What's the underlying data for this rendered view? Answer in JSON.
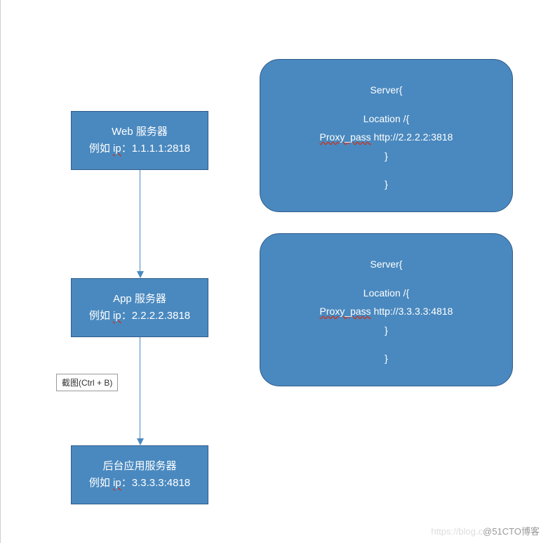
{
  "nodes": {
    "web": {
      "title": "Web 服务器",
      "subtitle_prefix": "例如 ",
      "subtitle_ip_label": "ip",
      "subtitle_value": "：1.1.1.1:2818"
    },
    "app": {
      "title": "App 服务器",
      "subtitle_prefix": "例如 ",
      "subtitle_ip_label": "ip",
      "subtitle_value": "：2.2.2.2.3818"
    },
    "backend": {
      "title": "后台应用服务器",
      "subtitle_prefix": "例如 ",
      "subtitle_ip_label": "ip",
      "subtitle_value": "：3.3.3.3:4818"
    }
  },
  "servers": {
    "top": {
      "header": "Server{",
      "location": "Location /{",
      "proxy_label": "Proxy_pass",
      "proxy_url": " http://2.2.2.2:3818",
      "close1": "}",
      "close2": "}"
    },
    "bottom": {
      "header": "Server{",
      "location": "Location /{",
      "proxy_label": "Proxy_pass",
      "proxy_url": " http://3.3.3.3:4818",
      "close1": "}",
      "close2": "}"
    }
  },
  "tooltip": "截图(Ctrl + B)",
  "watermark_faint": "https://blog.c",
  "watermark": "@51CTO博客"
}
